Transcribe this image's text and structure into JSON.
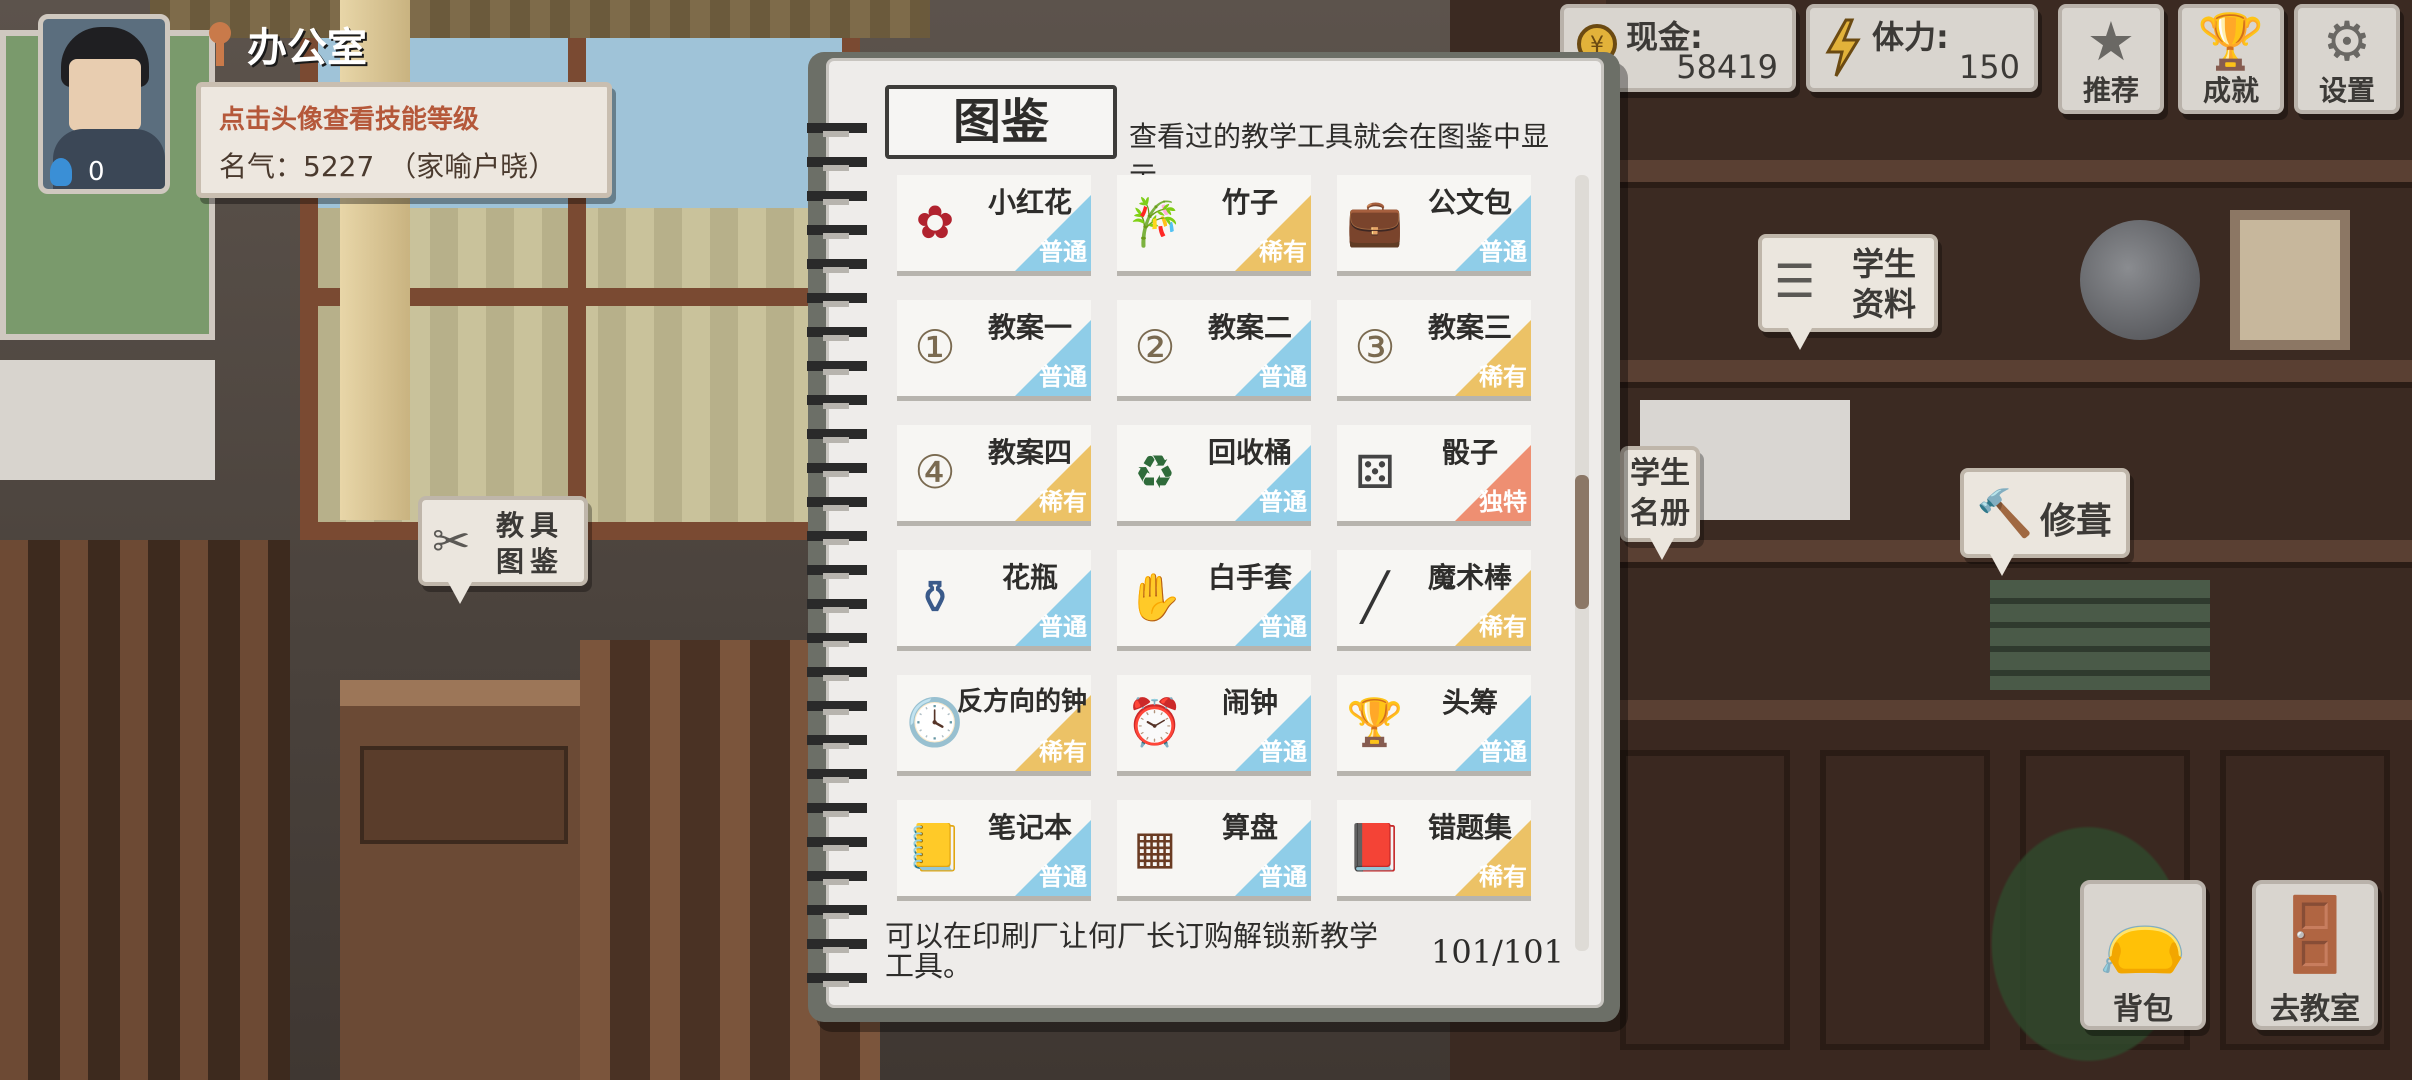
{
  "header": {
    "location": "办公室",
    "skill_level": "0",
    "hint": "点击头像查看技能等级",
    "fame": "名气：5227　（家喻户晓）"
  },
  "stats": {
    "cash_label": "现金:",
    "cash_value": "58419",
    "stamina_label": "体力:",
    "stamina_value": "150"
  },
  "top_buttons": {
    "recommend": "推荐",
    "achievements": "成就",
    "settings": "设置"
  },
  "bubbles": {
    "catalog": "教具图鉴",
    "student_info": "学生资料",
    "student_roster": "学生名册",
    "repair": "修葺"
  },
  "bottom_buttons": {
    "bag": "背包",
    "classroom": "去教室"
  },
  "catalog": {
    "title": "图鉴",
    "subtitle": "查看过的教学工具就会在图鉴中显示。",
    "tip": "可以在印刷厂让何厂长订购解锁新教学工具。",
    "counter": "101/101",
    "rarity_colors": {
      "普通": "#8fcde8",
      "稀有": "#ecc266",
      "独特": "#ee8f72"
    },
    "items": [
      {
        "name": "小红花",
        "rarity": "普通",
        "icon": "flower-icon"
      },
      {
        "name": "竹子",
        "rarity": "稀有",
        "icon": "bamboo-icon"
      },
      {
        "name": "公文包",
        "rarity": "普通",
        "icon": "briefcase-icon"
      },
      {
        "name": "教案一",
        "rarity": "普通",
        "icon": "lesson-plan-1-icon"
      },
      {
        "name": "教案二",
        "rarity": "普通",
        "icon": "lesson-plan-2-icon"
      },
      {
        "name": "教案三",
        "rarity": "稀有",
        "icon": "lesson-plan-3-icon"
      },
      {
        "name": "教案四",
        "rarity": "稀有",
        "icon": "lesson-plan-4-icon"
      },
      {
        "name": "回收桶",
        "rarity": "普通",
        "icon": "recycle-bin-icon"
      },
      {
        "name": "骰子",
        "rarity": "独特",
        "icon": "dice-icon"
      },
      {
        "name": "花瓶",
        "rarity": "普通",
        "icon": "vase-icon"
      },
      {
        "name": "白手套",
        "rarity": "普通",
        "icon": "glove-icon"
      },
      {
        "name": "魔术棒",
        "rarity": "稀有",
        "icon": "magic-wand-icon"
      },
      {
        "name": "反方向的钟",
        "rarity": "稀有",
        "icon": "clock-icon"
      },
      {
        "name": "闹钟",
        "rarity": "普通",
        "icon": "alarm-clock-icon"
      },
      {
        "name": "头筹",
        "rarity": "普通",
        "icon": "trophy-icon"
      },
      {
        "name": "笔记本",
        "rarity": "普通",
        "icon": "notebook-icon"
      },
      {
        "name": "算盘",
        "rarity": "普通",
        "icon": "abacus-icon"
      },
      {
        "name": "错题集",
        "rarity": "稀有",
        "icon": "mistake-book-icon"
      }
    ]
  }
}
